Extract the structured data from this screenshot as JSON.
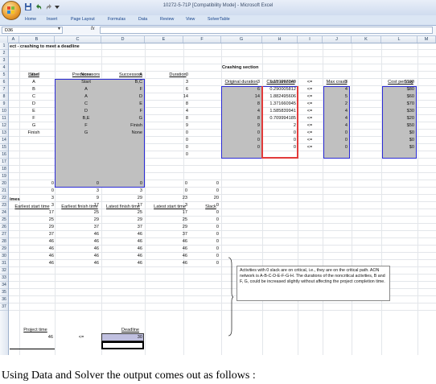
{
  "window": {
    "title": "10272-5-71P  [Compatibility Mode] - Microsoft Excel"
  },
  "ribbon": {
    "tabs": [
      "Home",
      "Insert",
      "Page Layout",
      "Formulas",
      "Data",
      "Review",
      "View",
      "SolverTable"
    ]
  },
  "formula_bar": {
    "name_box": "D36",
    "fx_label": "fx",
    "formula": ""
  },
  "columns": [
    "A",
    "B",
    "C",
    "D",
    "E",
    "F",
    "G",
    "H",
    "I",
    "J",
    "K",
    "L",
    "M"
  ],
  "rows": [
    "1",
    "2",
    "3",
    "4",
    "5",
    "6",
    "7",
    "8",
    "9",
    "10",
    "11",
    "12",
    "13",
    "14",
    "15",
    "16",
    "17",
    "18",
    "19",
    "20",
    "21",
    "22",
    "23",
    "24",
    "25",
    "26",
    "27",
    "28",
    "29",
    "30",
    "31",
    "32",
    "33",
    "34",
    "35",
    "36",
    "37"
  ],
  "sheet": {
    "row1_title": "ect - crashing to meet a deadline",
    "headers": {
      "label": "Label",
      "predecessors": "Predecessors",
      "successors": "Successors",
      "duration": "Duration"
    },
    "activities": [
      {
        "label": "Start",
        "pred": "None",
        "succ": "A",
        "dur": "0"
      },
      {
        "label": "A",
        "pred": "Start",
        "succ": "B,C",
        "dur": "3"
      },
      {
        "label": "B",
        "pred": "A",
        "succ": "F",
        "dur": "6"
      },
      {
        "label": "C",
        "pred": "A",
        "succ": "D",
        "dur": "14"
      },
      {
        "label": "D",
        "pred": "C",
        "succ": "E",
        "dur": "8"
      },
      {
        "label": "E",
        "pred": "D",
        "succ": "F",
        "dur": "4"
      },
      {
        "label": "F",
        "pred": "B,E",
        "succ": "G",
        "dur": "8"
      },
      {
        "label": "G",
        "pred": "F",
        "succ": "Finish",
        "dur": "9"
      },
      {
        "label": "Finish",
        "pred": "G",
        "succ": "None",
        "dur": "0"
      },
      {
        "label": "",
        "pred": "",
        "succ": "",
        "dur": "0"
      },
      {
        "label": "",
        "pred": "",
        "succ": "",
        "dur": "0"
      },
      {
        "label": "",
        "pred": "",
        "succ": "",
        "dur": "0"
      }
    ],
    "crashing": {
      "title": "Crashing section",
      "h_orig": "Original duration",
      "h_crash": "Crash amount",
      "h_max": "Max crash",
      "h_cost": "Cost per day",
      "rows": [
        {
          "orig": "3",
          "crash": "1.159997349",
          "op": "<=",
          "max": "3",
          "cost": "$100"
        },
        {
          "orig": "6",
          "crash": "0.290005812",
          "op": "<=",
          "max": "4",
          "cost": "$80"
        },
        {
          "orig": "14",
          "crash": "1.882495606",
          "op": "<=",
          "max": "5",
          "cost": "$60"
        },
        {
          "orig": "8",
          "crash": "1.371660945",
          "op": "<=",
          "max": "2",
          "cost": "$70"
        },
        {
          "orig": "4",
          "crash": "1.585839941",
          "op": "<=",
          "max": "4",
          "cost": "$30"
        },
        {
          "orig": "8",
          "crash": "0.709994185",
          "op": "<=",
          "max": "4",
          "cost": "$20"
        },
        {
          "orig": "9",
          "crash": "2",
          "op": "<=",
          "max": "4",
          "cost": "$50"
        },
        {
          "orig": "0",
          "crash": "0",
          "op": "<=",
          "max": "0",
          "cost": "$0"
        },
        {
          "orig": "0",
          "crash": "0",
          "op": "<=",
          "max": "0",
          "cost": "$0"
        },
        {
          "orig": "0",
          "crash": "0",
          "op": "<=",
          "max": "0",
          "cost": "$0"
        }
      ]
    },
    "times_title": "imes",
    "times_headers": {
      "es": "Earliest start time",
      "ef": "Earliest finish time",
      "lf": "Latest finish time",
      "ls": "Latest start time",
      "slack": "Slack"
    },
    "times": [
      {
        "es": "0",
        "ef": "0",
        "lf": "0",
        "ls": "0",
        "slack": "0"
      },
      {
        "es": "0",
        "ef": "3",
        "lf": "3",
        "ls": "0",
        "slack": "0"
      },
      {
        "es": "3",
        "ef": "9",
        "lf": "29",
        "ls": "23",
        "slack": "20"
      },
      {
        "es": "3",
        "ef": "17",
        "lf": "17",
        "ls": "3",
        "slack": "0"
      },
      {
        "es": "17",
        "ef": "25",
        "lf": "25",
        "ls": "17",
        "slack": "0"
      },
      {
        "es": "25",
        "ef": "29",
        "lf": "29",
        "ls": "25",
        "slack": "0"
      },
      {
        "es": "29",
        "ef": "37",
        "lf": "37",
        "ls": "29",
        "slack": "0"
      },
      {
        "es": "37",
        "ef": "46",
        "lf": "46",
        "ls": "37",
        "slack": "0"
      },
      {
        "es": "46",
        "ef": "46",
        "lf": "46",
        "ls": "46",
        "slack": "0"
      },
      {
        "es": "46",
        "ef": "46",
        "lf": "46",
        "ls": "46",
        "slack": "0"
      },
      {
        "es": "46",
        "ef": "46",
        "lf": "46",
        "ls": "46",
        "slack": "0"
      },
      {
        "es": "46",
        "ef": "46",
        "lf": "46",
        "ls": "46",
        "slack": "0"
      }
    ],
    "note": "Activities with 0 slack are on critical, i.e., they are on the critical path. AON network is A-B-C-D-E-F-G-H. The durations of the noncritical activities, B and F, G, could be increased slightly without affecting the project completion time.",
    "project_time_label": "Project time",
    "project_time": "46",
    "deadline_op": "<=",
    "deadline_label": "Deadline",
    "deadline": "30"
  },
  "caption": "Using Data and Solver the output comes out as follows :",
  "colors": {
    "gray_fill": "#c0c0c0",
    "blue_border": "#2b2bd6",
    "red_border": "#e23b3b",
    "deadline_fill": "#c0c0e0"
  }
}
